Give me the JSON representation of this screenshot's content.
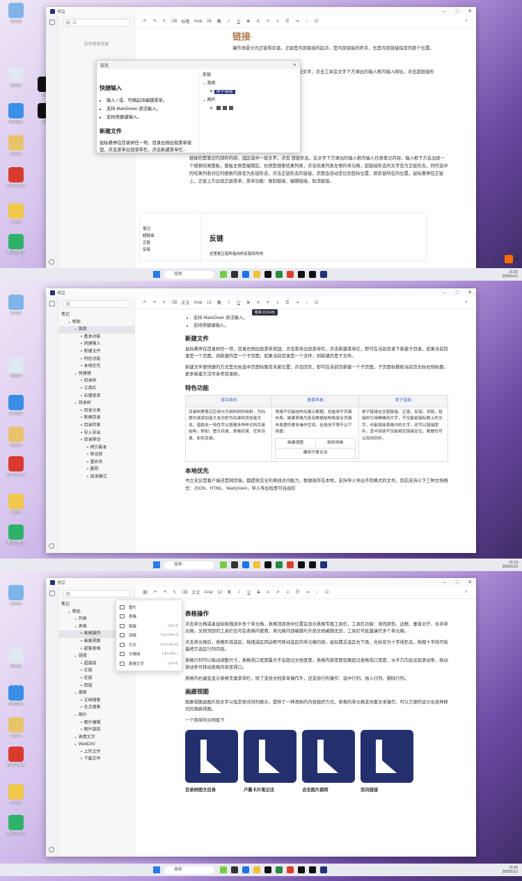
{
  "window": {
    "title": "书立"
  },
  "taskbar": {
    "search_placeholder": "搜索",
    "times": [
      {
        "time": "21:22",
        "date": "2025/1/12"
      },
      {
        "time": "21:19",
        "date": "2025/1/12"
      },
      {
        "time": "21:20",
        "date": "2025/1/12"
      }
    ]
  },
  "desktop": {
    "icons": [
      "此电脑",
      "回收站",
      "QQ",
      "控制面板",
      "抖音",
      "SIMS 4",
      "WPS Office",
      "Config",
      "腾讯应用宝"
    ]
  },
  "screen1": {
    "search_value": "11",
    "no_result": "没有搜索结果",
    "toolbar": {
      "heading": "标题",
      "font": "Arial",
      "size": "24"
    },
    "title": "链接",
    "dialog": {
      "title": "链接",
      "left_heading": "快捷输入",
      "left_items": [
        "输入 / 或、可唤起块编辑菜单。",
        "支持 MarkDown 语法输入。",
        "支持快捷键输入。"
      ],
      "left_heading2": "新建文件",
      "left_para": "鼠标悬停在目录树任一项，目录右侧出现菜单按钮，点击菜单出现菜单栏，点击新建菜单栏...",
      "right_label": "反链",
      "right_group1": "指南",
      "right_hl": "原子链接",
      "right_group2": "图片"
    },
    "para1_tail": "操作场景分为正链和反链。正链是内部链接的起点，是内部链接的终点，也是内部链接指定的那个位置。",
    "para2_tail": "打开网址对应的页面。选区选中一段文字，点击工具在文字下方弹出的输入框内输入网址。点击超链接形",
    "para3": "链接的是笔记内部的内容。选区选中一段文字，点击 双链形态，在文字下方弹出的输入框内输入任意笔记内容，输入框下方会出现一个搜索结果面板，面板左侧是编辑区，右侧是搜索结果列表，点击结果列表左侧的单元格，超链接形态的文字变为正链形态，同时选中的结果列表对应的搜索内容变为反链形态，点击正链形态的链接，页面会自动定位到目标位置，即反链所在的位置。鼠标悬停在正链上，正链上方出现正链菜单，菜单功能：复制链接、编辑链接、取消链接。",
    "mini": {
      "items": [
        "笔记",
        "超链接",
        "正链",
        "反链"
      ],
      "heading": "反链",
      "para": "这里是正链所指向的反链目的地"
    }
  },
  "screen2": {
    "toolbar": {
      "heading": "正文",
      "font": "Arial",
      "size": "12",
      "tooltip": "粗体 (Ctrl+B)"
    },
    "tree": [
      {
        "label": "笔记",
        "level": 0
      },
      {
        "label": "帮助",
        "level": 1
      },
      {
        "label": "指南",
        "level": 2,
        "sel": true
      },
      {
        "label": "基本功能",
        "level": 3
      },
      {
        "label": "快捷输入",
        "level": 3
      },
      {
        "label": "新建文件",
        "level": 3
      },
      {
        "label": "特色功能",
        "level": 3
      },
      {
        "label": "本地优先",
        "level": 3
      },
      {
        "label": "快捷键",
        "level": 2
      },
      {
        "label": "目录树",
        "level": 3
      },
      {
        "label": "工具栏",
        "level": 3
      },
      {
        "label": "右键菜单",
        "level": 3
      },
      {
        "label": "目录树",
        "level": 2
      },
      {
        "label": "目录分类",
        "level": 3
      },
      {
        "label": "新建目录",
        "level": 3
      },
      {
        "label": "目录检索",
        "level": 3
      },
      {
        "label": "导入导出",
        "level": 3
      },
      {
        "label": "目录移动",
        "level": 3
      },
      {
        "label": "拷贝副本",
        "level": 4
      },
      {
        "label": "移动到",
        "level": 4
      },
      {
        "label": "重命名",
        "level": 4
      },
      {
        "label": "删除",
        "level": 4
      },
      {
        "label": "阅读模式",
        "level": 4
      }
    ],
    "bullets": [
      "支持 MarkDown 语法输入。",
      "支持快捷键输入。"
    ],
    "h_new": "新建文件",
    "p_new1": "鼠标悬停在目录树任一项，目录右侧出现菜单按钮，点击菜单出现菜单栏，点击新建菜单栏，即可在当前目录下新建子目录，如果当前目录是一个页面，则新建的是一个子页面，如果当前目录是一个文件，则新建的是子文件。",
    "p_new2": "新建文件更快捷的方式是光标选中页面标题非末尾位置，点击回车，即可在当前页新建一个子页面，子页面标题取当前页光标右侧标题。更多新建方法可参考目录树。",
    "h_feat": "特色功能",
    "feat": {
      "headers": [
        "富目录树",
        "嵌套表格",
        "原子链接"
      ],
      "col1": "目录树是笔记应用与大纲的树形映射，为标题大纲添加富文本也即为目录树添加富文本。借助这一特性可以搭建多种样式的目录结构，例如：图文目录、表格目录、任务目录、彩色目录。",
      "col2": "表格不仅能结构化展示数据，也能用于页面布局，嵌套表格为复杂数据结构和复杂页面布局提供更多操作空间。包括但不限于以下场景：",
      "inner": [
        "画廊视图",
        "树形网格",
        "康奈尔笔记法"
      ],
      "col3": "原子链接包含超链接、正链、反链、双链，链接的引用精确到文字，不仅能链接标题上的文字，也能链接表格内的文字，还可以链接图片。其中双链不仅能相互链接定位，数据也可以双向同步。"
    },
    "h_local": "本地优先",
    "p_local": "书立无论是客户端还是网页端，都提供完全的离线访问能力，数据保存在本地，支持导入导出不同格式的文件，目前支持以下三种文档格式：JSON、HTML、MarkDown，导入导出粒度可自由控"
  },
  "screen3": {
    "toolbar": {
      "heading": "正文",
      "font": "Arial",
      "size": "12"
    },
    "tree": [
      {
        "label": "笔记",
        "level": 0
      },
      {
        "label": "帮助",
        "level": 1
      },
      {
        "label": "列表",
        "level": 2
      },
      {
        "label": "表格",
        "level": 2
      },
      {
        "label": "表格操作",
        "level": 3,
        "sel": true
      },
      {
        "label": "画廊视图",
        "level": 3
      },
      {
        "label": "嵌套表格",
        "level": 3
      },
      {
        "label": "链接",
        "level": 2
      },
      {
        "label": "超链接",
        "level": 3
      },
      {
        "label": "正链",
        "level": 3
      },
      {
        "label": "反链",
        "level": 3
      },
      {
        "label": "双链",
        "level": 3
      },
      {
        "label": "搜索",
        "level": 2
      },
      {
        "label": "文档搜索",
        "level": 3
      },
      {
        "label": "全文搜索",
        "level": 3
      },
      {
        "label": "图片",
        "level": 2
      },
      {
        "label": "图片编辑",
        "level": 3
      },
      {
        "label": "图片链接",
        "level": 3
      },
      {
        "label": "表情文字",
        "level": 2
      },
      {
        "label": "WebDAV",
        "level": 2
      },
      {
        "label": "上传文件",
        "level": 3
      },
      {
        "label": "下载文件",
        "level": 3
      }
    ],
    "menu": [
      {
        "label": "图片",
        "shortcut": ""
      },
      {
        "label": "表格",
        "shortcut": "›"
      },
      {
        "label": "链接",
        "shortcut": "Ctrl+K"
      },
      {
        "label": "双链",
        "shortcut": "Ctrl+Alt+S"
      },
      {
        "label": "引文",
        "shortcut": "Ctrl+Alt+Q"
      },
      {
        "label": "分隔线",
        "shortcut": "Ctrl+Alt+-"
      },
      {
        "label": "表情文字",
        "shortcut": "Ctrl+E"
      }
    ],
    "h_table": "表格操作",
    "p1": "点击单元格或者鼠标拖拽选中多个单元格，表格顶部居中位置会显示表格专属工具栏，工具栏功能：填充颜色、边框、垂直对齐、合并单元格。文档顶部的工具栏也可在表格内使用，单元格内部编辑与外部文档编辑无异，工具栏可批量操作多个单元格。",
    "p2": "点击单元格后，表格形成选区，拖拽选区四边框可移动选区的单元格内容。鼠标靠近选区右下角，光标变为十字线形态，拖拽十字线可批量拷贝选区行列内容。",
    "p3": "表格行列可以拖动调整尺寸，表格视口宽度最大不会超过文档宽度，表格内容宽度如果超过表格视口宽度，水平方向会出现滚动条，拖动滚动条可移动表格内容至视口。",
    "p4": "表格内右键会显示表格专属菜单栏，除了支持文档菜单操作外，还支持行列操作：选中行列、插入行列、删除行列。",
    "h_gallery": "画廊视图",
    "p5": "画廊视图由图片和文字以指定样式排列展示，提供了一种清晰的内容组织方式。表格的单元格支持富文本操作，可以方便的设计出各种样式的画廊视图。",
    "p6": "一个简单的示例如下",
    "gallery": [
      "目录树图文目录",
      "卢曼卡片笔记法",
      "点击图片跳转",
      "双向链接"
    ]
  }
}
